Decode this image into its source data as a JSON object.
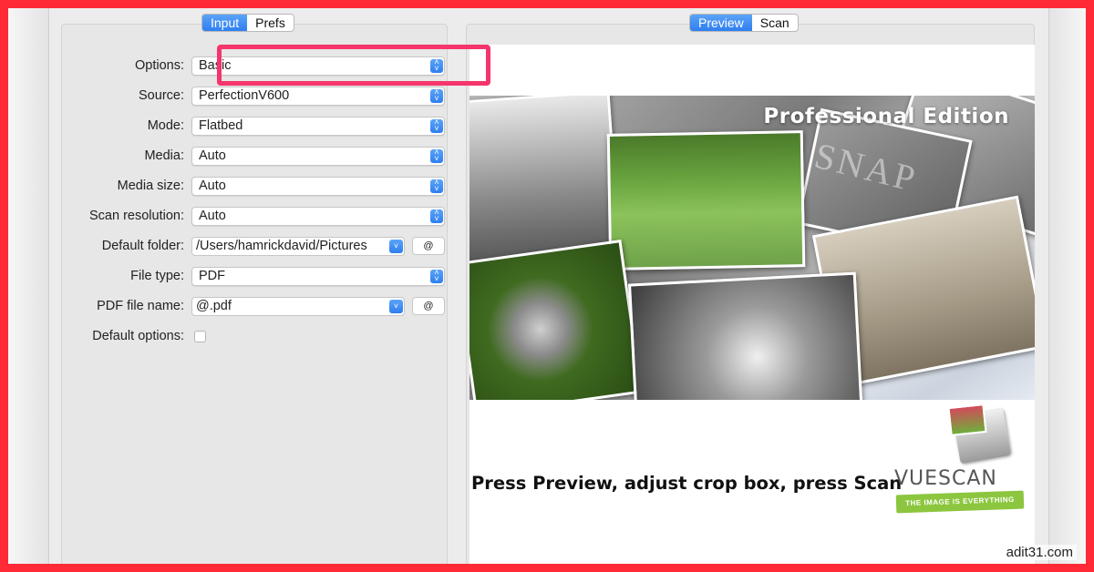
{
  "tabs_left": {
    "input": "Input",
    "prefs": "Prefs"
  },
  "tabs_right": {
    "preview": "Preview",
    "scan": "Scan"
  },
  "form": {
    "options": {
      "label": "Options:",
      "value": "Basic"
    },
    "source": {
      "label": "Source:",
      "value": "PerfectionV600"
    },
    "mode": {
      "label": "Mode:",
      "value": "Flatbed"
    },
    "media": {
      "label": "Media:",
      "value": "Auto"
    },
    "media_size": {
      "label": "Media size:",
      "value": "Auto"
    },
    "scan_resolution": {
      "label": "Scan resolution:",
      "value": "Auto"
    },
    "default_folder": {
      "label": "Default folder:",
      "value": "/Users/hamrickdavid/Pictures",
      "at_button": "@"
    },
    "file_type": {
      "label": "File type:",
      "value": "PDF"
    },
    "pdf_file_name": {
      "label": "PDF file name:",
      "value": "@.pdf",
      "at_button": "@"
    },
    "default_options": {
      "label": "Default options:",
      "checked": false
    }
  },
  "preview": {
    "banner_title": "Professional Edition",
    "snap_text": "SNAP",
    "instruction": "Press Preview, adjust crop box, press Scan",
    "logo_text": "VUESCAN",
    "logo_tagline": "THE IMAGE IS EVERYTHING"
  },
  "watermark": "adit31.com",
  "colors": {
    "border": "#ff2a36",
    "highlight": "#f5356c",
    "accent": "#2f7ff0"
  }
}
